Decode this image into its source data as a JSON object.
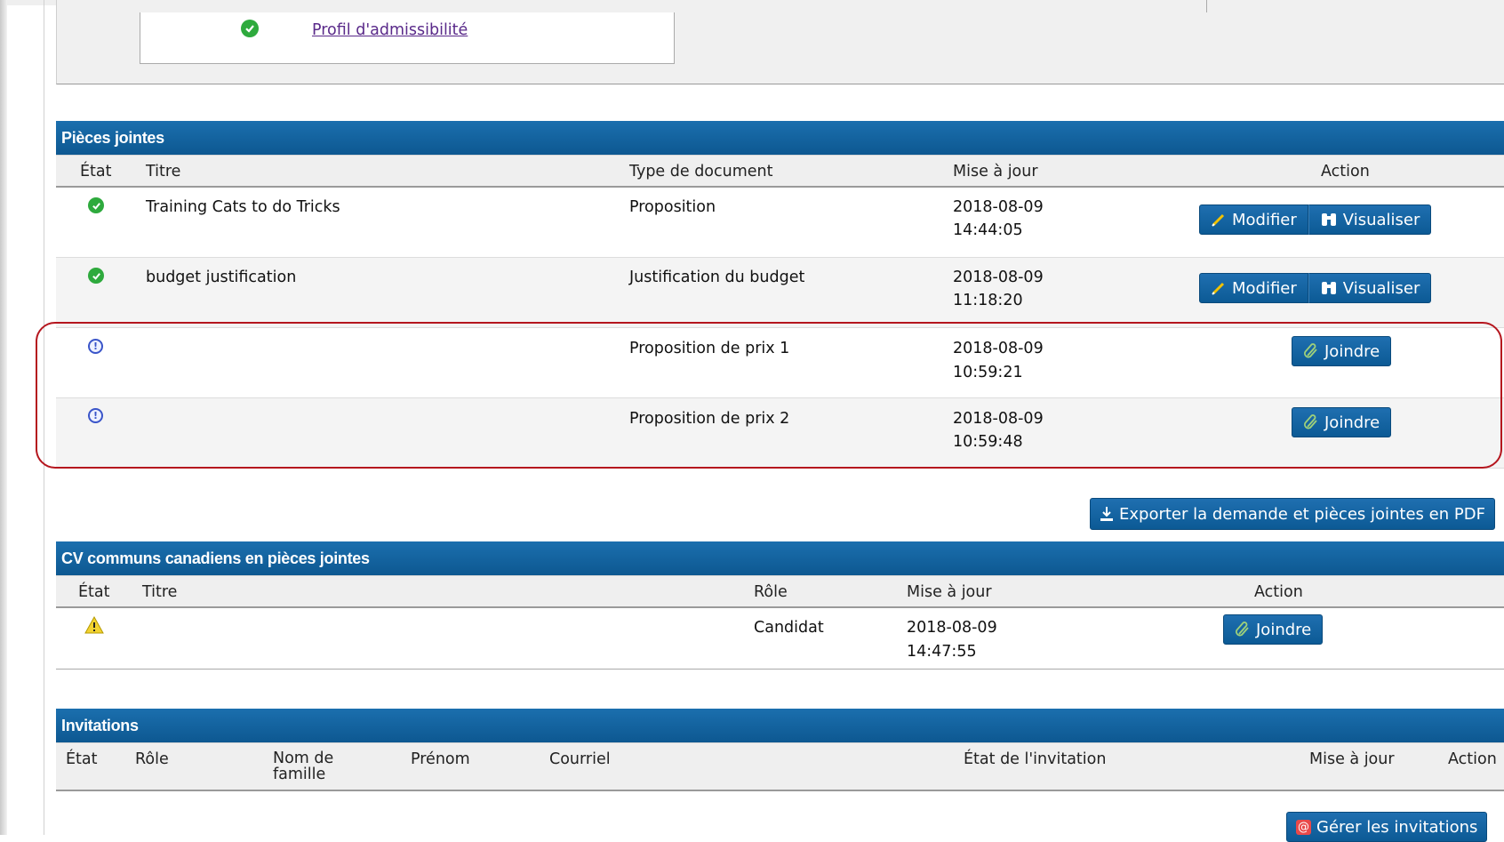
{
  "profile_box": {
    "link": "Profil d'admissibilité"
  },
  "attachments": {
    "title": "Pièces jointes",
    "columns": [
      "État",
      "Titre",
      "Type de document",
      "Mise à jour",
      "Action"
    ],
    "rows": [
      {
        "status": "complete",
        "title": "Training Cats to do Tricks",
        "type": "Proposition",
        "date": "2018-08-09",
        "time": "14:44:05",
        "actions": [
          "Modifier",
          "Visualiser"
        ]
      },
      {
        "status": "complete",
        "title": "budget justification",
        "type": "Justification du budget",
        "date": "2018-08-09",
        "time": "11:18:20",
        "actions": [
          "Modifier",
          "Visualiser"
        ]
      },
      {
        "status": "pending",
        "title": "",
        "type": "Proposition de prix 1",
        "date": "2018-08-09",
        "time": "10:59:21",
        "actions": [
          "Joindre"
        ]
      },
      {
        "status": "pending",
        "title": "",
        "type": "Proposition de prix 2",
        "date": "2018-08-09",
        "time": "10:59:48",
        "actions": [
          "Joindre"
        ]
      }
    ],
    "export_button": "Exporter la demande et pièces jointes en PDF"
  },
  "cv": {
    "title": "CV communs canadiens en pièces jointes",
    "columns": [
      "État",
      "Titre",
      "Rôle",
      "Mise à jour",
      "Action"
    ],
    "rows": [
      {
        "status": "warning",
        "title": "",
        "role": "Candidat",
        "date": "2018-08-09",
        "time": "14:47:55",
        "action": "Joindre"
      }
    ]
  },
  "invitations": {
    "title": "Invitations",
    "columns": [
      "État",
      "Rôle",
      "Nom de famille",
      "Prénom",
      "Courriel",
      "État de l'invitation",
      "Mise à jour",
      "Action"
    ],
    "manage_button": "Gérer les invitations"
  },
  "colors": {
    "header_blue": "#0d5891",
    "button_blue": "#1f6fb0",
    "ok_green": "#2eaa3d",
    "info_blue": "#3a55c9",
    "highlight_red": "#b5161e",
    "link_purple": "#5a2a8a"
  }
}
